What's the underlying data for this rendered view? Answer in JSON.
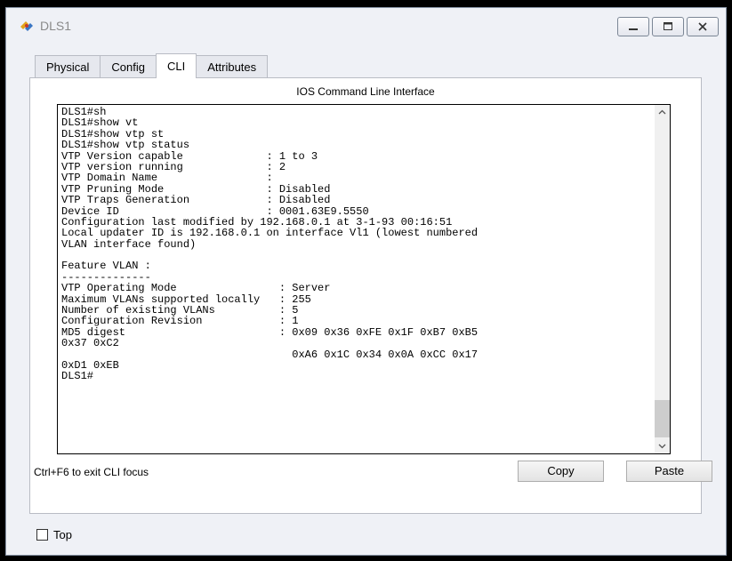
{
  "window": {
    "title": "DLS1",
    "app_icon": "packet-tracer-switch-icon",
    "buttons": [
      {
        "name": "minimize-button",
        "icon": "minimize-icon"
      },
      {
        "name": "maximize-button",
        "icon": "maximize-icon"
      },
      {
        "name": "close-button",
        "icon": "close-icon"
      }
    ]
  },
  "tabs": [
    {
      "label": "Physical",
      "active": false
    },
    {
      "label": "Config",
      "active": false
    },
    {
      "label": "CLI",
      "active": true
    },
    {
      "label": "Attributes",
      "active": false
    }
  ],
  "cli": {
    "heading": "IOS Command Line Interface",
    "lines": [
      "DLS1#sh",
      "DLS1#show vt",
      "DLS1#show vtp st",
      "DLS1#show vtp status",
      "VTP Version capable             : 1 to 3",
      "VTP version running             : 2",
      "VTP Domain Name                 :",
      "VTP Pruning Mode                : Disabled",
      "VTP Traps Generation            : Disabled",
      "Device ID                       : 0001.63E9.5550",
      "Configuration last modified by 192.168.0.1 at 3-1-93 00:16:51",
      "Local updater ID is 192.168.0.1 on interface Vl1 (lowest numbered",
      "VLAN interface found)",
      "",
      "Feature VLAN :",
      "--------------",
      "VTP Operating Mode                : Server",
      "Maximum VLANs supported locally   : 255",
      "Number of existing VLANs          : 5",
      "Configuration Revision            : 1",
      "MD5 digest                        : 0x09 0x36 0xFE 0x1F 0xB7 0xB5",
      "0x37 0xC2",
      "                                    0xA6 0x1C 0x34 0x0A 0xCC 0x17",
      "0xD1 0xEB",
      "DLS1#"
    ],
    "scroll_position": 1.0
  },
  "footer": {
    "focus_hint": "Ctrl+F6 to exit CLI focus",
    "copy_label": "Copy",
    "paste_label": "Paste"
  },
  "bottom": {
    "top_label": "Top",
    "top_checked": false
  },
  "colors": {
    "window_bg": "#eff1f6",
    "panel_bg": "#ffffff",
    "terminal_border": "#000000"
  }
}
